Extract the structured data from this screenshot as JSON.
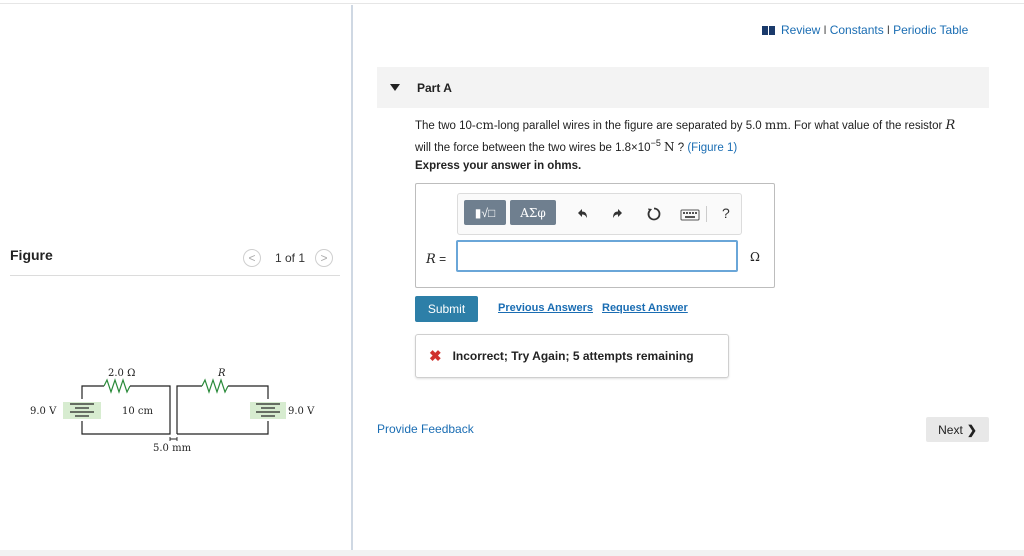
{
  "top_links": {
    "review": "Review",
    "sep": "I",
    "constants": "Constants",
    "periodic": "Periodic Table"
  },
  "figure_panel": {
    "title": "Figure",
    "pager": {
      "text": "1 of 1",
      "prev": "<",
      "next": ">"
    },
    "circuit": {
      "battery_left": "9.0 V",
      "battery_right": "9.0 V",
      "resistor_left": "2.0 Ω",
      "resistor_right": "R",
      "wire_length": "10 cm",
      "separation": "5.0 mm"
    }
  },
  "part": {
    "title": "Part A"
  },
  "question": {
    "t1": "The two 10-",
    "u1": "cm",
    "t2": "-long parallel wires in the figure are separated by 5.0 ",
    "u2": "mm",
    "t3": ". For what value of the resistor ",
    "var": "R",
    "t4": "will the force between the two wires be 1.8×10",
    "exp": "−5",
    "u3": "N",
    "t5": " ? ",
    "figure_link": "(Figure 1)",
    "express": "Express your answer in ohms."
  },
  "answer": {
    "label_var": "R",
    "label_eq": " =",
    "value": "",
    "unit": "Ω",
    "toolbar": {
      "templates": "▮√□",
      "greek": "ΑΣφ",
      "help": "?"
    }
  },
  "actions": {
    "submit": "Submit",
    "previous_answers": "Previous Answers",
    "request_answer": "Request Answer"
  },
  "feedback": {
    "icon": "✖",
    "text": "Incorrect; Try Again; 5 attempts remaining"
  },
  "footer": {
    "provide_feedback": "Provide Feedback",
    "next": "Next",
    "next_chev": "❯"
  },
  "colors": {
    "link": "#1a6db3",
    "submit": "#2d7fa8",
    "error": "#d0312d",
    "input_border": "#6aa6d8"
  }
}
